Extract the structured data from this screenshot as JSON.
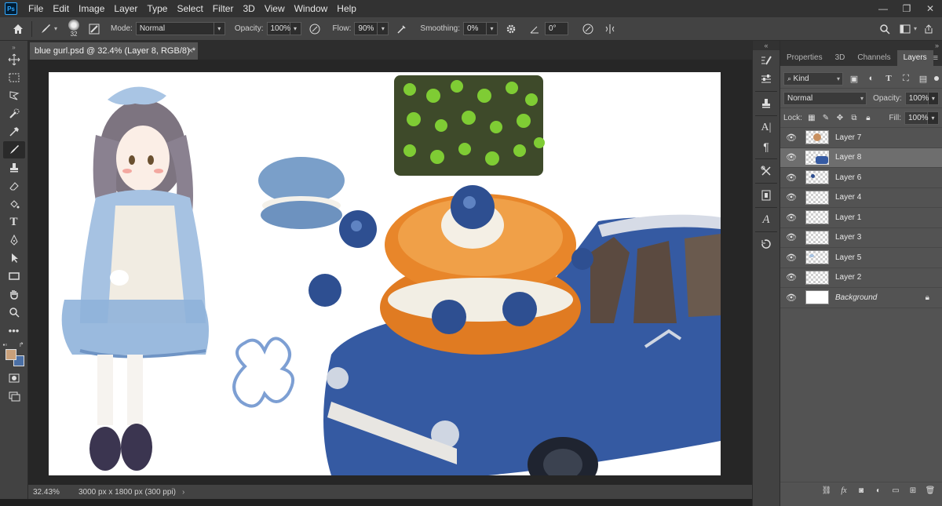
{
  "app": {
    "logo_text": "Ps"
  },
  "menu": [
    "File",
    "Edit",
    "Image",
    "Layer",
    "Type",
    "Select",
    "Filter",
    "3D",
    "View",
    "Window",
    "Help"
  ],
  "window_controls": {
    "minimize": "—",
    "restore": "❐",
    "close": "✕"
  },
  "options_bar": {
    "brush_size": "32",
    "mode_label": "Mode:",
    "mode_value": "Normal",
    "opacity_label": "Opacity:",
    "opacity_value": "100%",
    "flow_label": "Flow:",
    "flow_value": "90%",
    "smoothing_label": "Smoothing:",
    "smoothing_value": "0%",
    "angle_value": "0°"
  },
  "document": {
    "tab_title": "blue gurl.psd @ 32.4% (Layer 8, RGB/8) *",
    "close": "×"
  },
  "status": {
    "zoom": "32.43%",
    "doc_info": "3000 px x 1800 px (300 ppi)",
    "arrow": "›"
  },
  "panel_tabs": [
    "Properties",
    "3D",
    "Channels",
    "Layers"
  ],
  "layers_panel": {
    "filter_kind": "Kind",
    "blend_mode": "Normal",
    "opacity_label": "Opacity:",
    "opacity_value": "100%",
    "lock_label": "Lock:",
    "fill_label": "Fill:",
    "fill_value": "100%",
    "layers": [
      {
        "name": "Layer 7",
        "selected": false
      },
      {
        "name": "Layer 8",
        "selected": true
      },
      {
        "name": "Layer 6",
        "selected": false
      },
      {
        "name": "Layer 4",
        "selected": false
      },
      {
        "name": "Layer 1",
        "selected": false
      },
      {
        "name": "Layer 3",
        "selected": false
      },
      {
        "name": "Layer 5",
        "selected": false
      },
      {
        "name": "Layer 2",
        "selected": false
      },
      {
        "name": "Background",
        "selected": false
      }
    ]
  },
  "colors": {
    "foreground": "#c9a07a",
    "background": "#4a6fa5"
  }
}
